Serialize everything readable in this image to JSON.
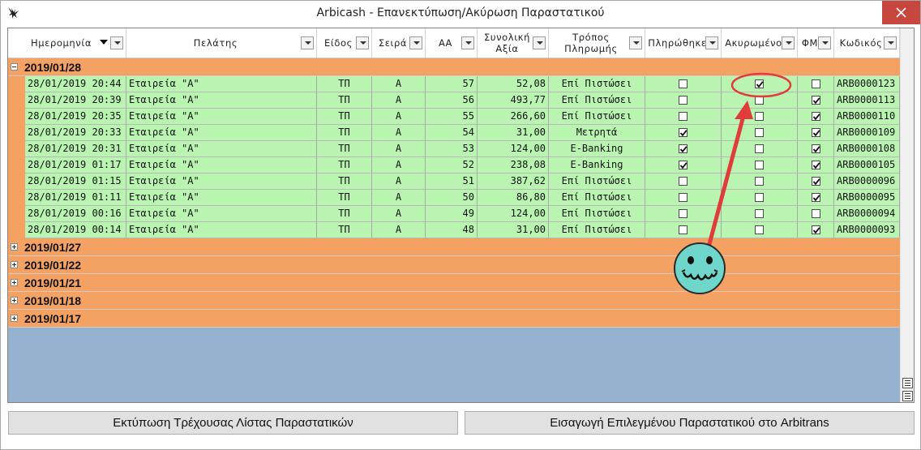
{
  "window": {
    "title": "Arbicash - Επανεκτύπωση/Ακύρωση Παραστατικού"
  },
  "colors": {
    "group_row": "#f4a263",
    "data_row": "#b9f5b1",
    "grid_empty": "#97b2cf",
    "close_button": "#c7463e",
    "annotation": "#e03c3c",
    "smiley": "#6fd6cc"
  },
  "icons": {
    "app": "eagle-icon",
    "close": "close-icon",
    "sort": "sort-desc-icon",
    "filter": "filter-dropdown-icon",
    "expand": "plus-icon",
    "collapse": "minus-icon",
    "check": "checkmark-icon"
  },
  "columns": [
    {
      "label": "Ημερομηνία",
      "sorted": "desc"
    },
    {
      "label": "Πελάτης"
    },
    {
      "label": "Είδος"
    },
    {
      "label": "Σειρά"
    },
    {
      "label": "ΑΑ"
    },
    {
      "label": "Συνολική\nΑξία"
    },
    {
      "label": "Τρόπος\nΠληρωμής"
    },
    {
      "label": "Πληρώθηκε"
    },
    {
      "label": "Ακυρωμένο"
    },
    {
      "label": "ΦΜ"
    },
    {
      "label": "Κωδικός"
    }
  ],
  "groups": [
    {
      "label": "2019/01/28",
      "expanded": true
    },
    {
      "label": "2019/01/27",
      "expanded": false
    },
    {
      "label": "2019/01/22",
      "expanded": false
    },
    {
      "label": "2019/01/21",
      "expanded": false
    },
    {
      "label": "2019/01/18",
      "expanded": false
    },
    {
      "label": "2019/01/17",
      "expanded": false
    }
  ],
  "rows": [
    {
      "date": "28/01/2019 20:44",
      "customer": "Εταιρεία \"Α\"",
      "type": "ΤΠ",
      "series": "Α",
      "aa": "57",
      "total": "52,08",
      "payment": "Επί Πιστώσει",
      "paid": false,
      "cancelled": true,
      "fm": false,
      "code": "ARB0000123"
    },
    {
      "date": "28/01/2019 20:39",
      "customer": "Εταιρεία \"Α\"",
      "type": "ΤΠ",
      "series": "Α",
      "aa": "56",
      "total": "493,77",
      "payment": "Επί Πιστώσει",
      "paid": false,
      "cancelled": false,
      "fm": true,
      "code": "ARB0000113"
    },
    {
      "date": "28/01/2019 20:35",
      "customer": "Εταιρεία \"Α\"",
      "type": "ΤΠ",
      "series": "Α",
      "aa": "55",
      "total": "266,60",
      "payment": "Επί Πιστώσει",
      "paid": false,
      "cancelled": false,
      "fm": true,
      "code": "ARB0000110"
    },
    {
      "date": "28/01/2019 20:33",
      "customer": "Εταιρεία \"Α\"",
      "type": "ΤΠ",
      "series": "Α",
      "aa": "54",
      "total": "31,00",
      "payment": "Μετρητά",
      "paid": true,
      "cancelled": false,
      "fm": true,
      "code": "ARB0000109"
    },
    {
      "date": "28/01/2019 20:31",
      "customer": "Εταιρεία \"Α\"",
      "type": "ΤΠ",
      "series": "Α",
      "aa": "53",
      "total": "124,00",
      "payment": "E-Banking",
      "paid": true,
      "cancelled": false,
      "fm": true,
      "code": "ARB0000108"
    },
    {
      "date": "28/01/2019 01:17",
      "customer": "Εταιρεία \"Α\"",
      "type": "ΤΠ",
      "series": "Α",
      "aa": "52",
      "total": "238,08",
      "payment": "E-Banking",
      "paid": true,
      "cancelled": false,
      "fm": true,
      "code": "ARB0000105"
    },
    {
      "date": "28/01/2019 01:15",
      "customer": "Εταιρεία \"Α\"",
      "type": "ΤΠ",
      "series": "Α",
      "aa": "51",
      "total": "387,62",
      "payment": "Επί Πιστώσει",
      "paid": false,
      "cancelled": false,
      "fm": true,
      "code": "ARB0000096"
    },
    {
      "date": "28/01/2019 01:11",
      "customer": "Εταιρεία \"Α\"",
      "type": "ΤΠ",
      "series": "Α",
      "aa": "50",
      "total": "86,80",
      "payment": "Επί Πιστώσει",
      "paid": false,
      "cancelled": false,
      "fm": true,
      "code": "ARB0000095"
    },
    {
      "date": "28/01/2019 00:16",
      "customer": "Εταιρεία \"Α\"",
      "type": "ΤΠ",
      "series": "Α",
      "aa": "49",
      "total": "124,00",
      "payment": "Επί Πιστώσει",
      "paid": false,
      "cancelled": false,
      "fm": false,
      "code": "ARB0000094"
    },
    {
      "date": "28/01/2019 00:14",
      "customer": "Εταιρεία \"Α\"",
      "type": "ΤΠ",
      "series": "Α",
      "aa": "48",
      "total": "31,00",
      "payment": "Επί Πιστώσει",
      "paid": false,
      "cancelled": false,
      "fm": true,
      "code": "ARB0000093"
    }
  ],
  "buttons": {
    "print_list": "Εκτύπωση Τρέχουσας Λίστας Παραστατικών",
    "import_selected": "Εισαγωγή Επιλεγμένου Παραστατικού στο Arbitrans"
  }
}
